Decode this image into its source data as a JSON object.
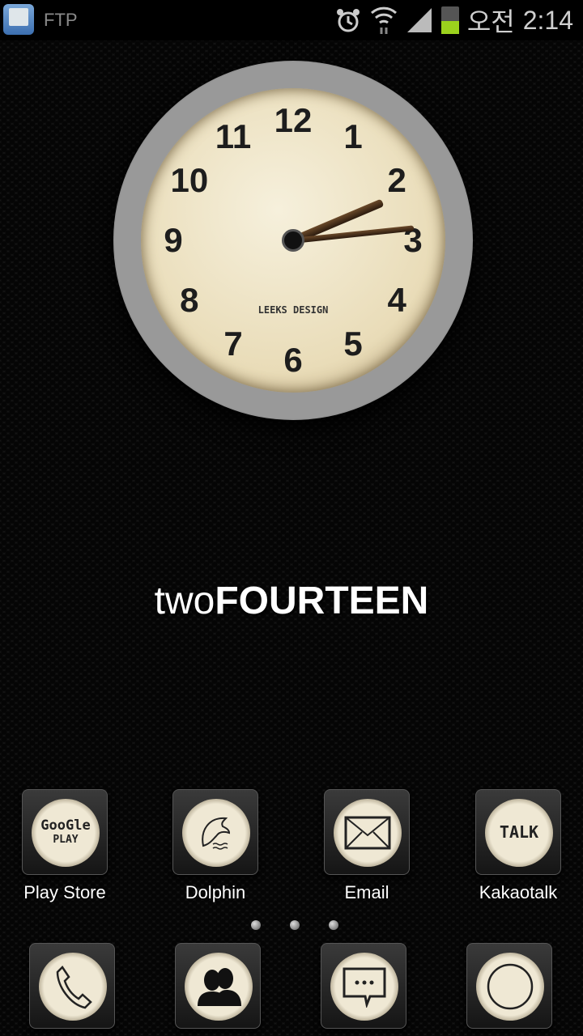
{
  "status_bar": {
    "app_name": "FTP",
    "icons": [
      "ftp-app-icon",
      "alarm-icon",
      "wifi-icon",
      "signal-icon",
      "battery-icon"
    ],
    "ampm": "오전",
    "time": "2:14",
    "battery_color": "#9bd11d"
  },
  "clock": {
    "brand": "LEEKS DESIGN",
    "numbers": [
      "12",
      "1",
      "2",
      "3",
      "4",
      "5",
      "6",
      "7",
      "8",
      "9",
      "10",
      "11"
    ],
    "hour": 2,
    "minute": 14
  },
  "title": {
    "light": "two",
    "bold": "FOURTEEN"
  },
  "apps": [
    {
      "label": "Play Store",
      "icon": "google-play-icon",
      "text1": "GooGle",
      "text2": "PLAY"
    },
    {
      "label": "Dolphin",
      "icon": "dolphin-icon"
    },
    {
      "label": "Email",
      "icon": "envelope-icon"
    },
    {
      "label": "Kakaotalk",
      "icon": "talk-icon",
      "text1": "TALK"
    }
  ],
  "page_indicator": {
    "count": 3,
    "active": 1
  },
  "dock": [
    {
      "icon": "phone-icon"
    },
    {
      "icon": "contacts-icon"
    },
    {
      "icon": "messaging-icon"
    },
    {
      "icon": "circle-icon"
    }
  ]
}
